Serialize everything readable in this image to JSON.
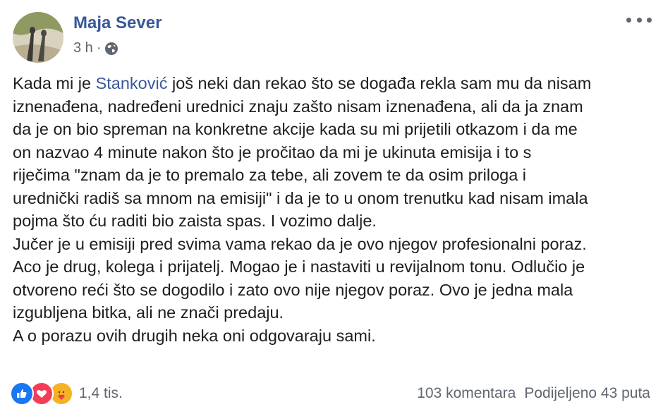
{
  "post": {
    "author": "Maja Sever",
    "time": "3 h",
    "separator": "·",
    "privacy_icon": "globe-icon",
    "more_icon": "more-options-icon",
    "text": {
      "line1_before": "Kada mi je ",
      "mention": "Stanković",
      "line1_after": " još neki dan rekao što se događa rekla sam mu da nisam",
      "lines": [
        "iznenađena, nadređeni urednici znaju zašto nisam iznenađena, ali da ja znam",
        "da je on bio spreman na konkretne akcije kada su mi prijetili otkazom i da me",
        "on nazvao 4 minute nakon što je pročitao da mi je ukinuta emisija i to s",
        "riječima \"znam da je to premalo za tebe, ali zovem te da osim priloga i",
        "urednički radiš sa mnom na emisiji\" i da je to u onom trenutku kad nisam imala",
        "pojma što ću raditi bio zaista spas. I vozimo dalje.",
        "Jučer je u emisiji pred svima vama rekao da je ovo njegov profesionalni poraz.",
        "Aco je drug, kolega i prijatelj. Mogao je i nastaviti u revijalnom tonu. Odlučio je",
        "otvoreno reći što se dogodilo i zato ovo nije njegov poraz. Ovo je jedna mala",
        "izgubljena bitka, ali ne znači predaju.",
        "A o porazu ovih drugih neka oni odgovaraju sami."
      ]
    },
    "footer": {
      "reaction_icons": [
        "like-icon",
        "love-icon",
        "care-icon"
      ],
      "reactions_count": "1,4 tis.",
      "comments": "103 komentara",
      "shares": "Podijeljeno 43 puta"
    },
    "colors": {
      "author": "#385898",
      "like": "#1877f2",
      "love": "#f33e58",
      "care": "#f7b125"
    }
  }
}
